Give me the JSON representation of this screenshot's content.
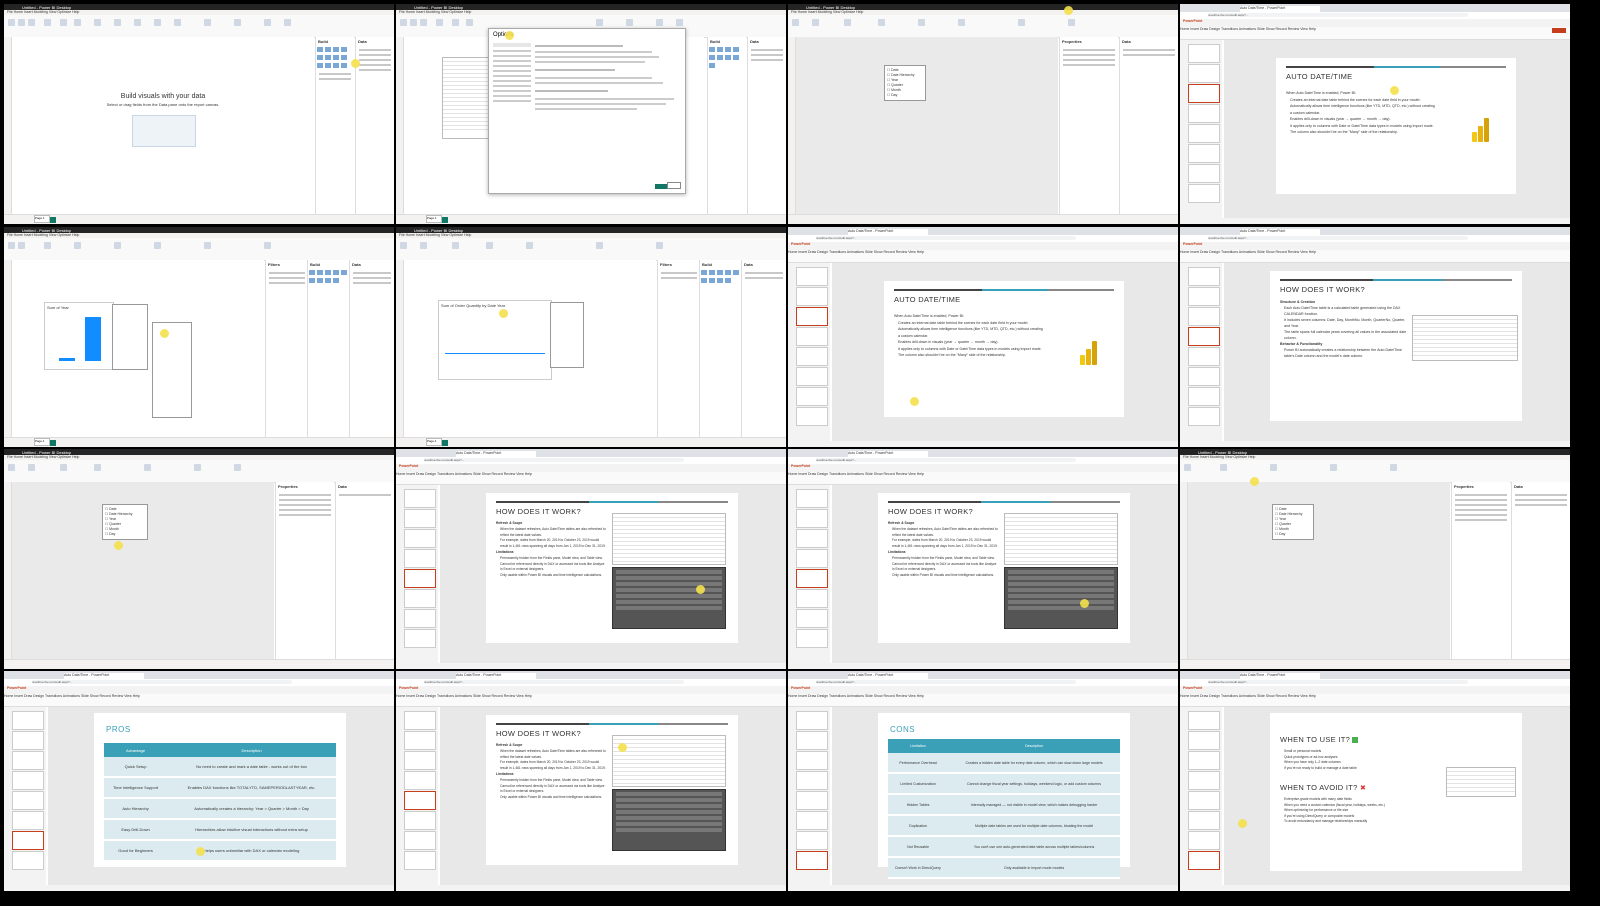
{
  "pbi": {
    "title": "Untitled - Power BI Desktop",
    "menu": "File Home Insert Modeling View Optimize Help",
    "build_title": "Build",
    "data_title": "Data",
    "filters_title": "Filters",
    "properties_title": "Properties",
    "page_tab": "Page 1",
    "empty_heading": "Build visuals with your data",
    "empty_sub": "Select or drag fields from the Data pane onto the report canvas.",
    "options_title": "Options",
    "chart1_title": "Sum of Year",
    "chart2_title": "Sum of Order Quantity by Date Year",
    "table_name": "Date",
    "date_fields": [
      "Date",
      "Date Hierarchy",
      "Year",
      "Quarter",
      "Month",
      "Day"
    ]
  },
  "browser": {
    "tab": "Auto Date/Time - PowerPoint",
    "url": "onedrive.live.com/edit.aspx?..."
  },
  "ppt": {
    "app": "PowerPoint",
    "ribbon": "Home Insert Draw Design Transitions Animations Slide Show Record Review View Help"
  },
  "slides": {
    "autodate": {
      "title": "AUTO DATE/TIME",
      "intro": "When Auto Date/Time is enabled, Power BI:",
      "bullets": [
        "Creates an internal date table behind the scenes for each date field in your model.",
        "Automatically allows time intelligence functions (like YTD, MTD, QTD, etc.) without creating a custom calendar.",
        "Enables drill-down in visuals (year → quarter → month → day).",
        "It applies only to columns with Date or Date/Time data types in models using Import mode. The column also shouldn't be on the \"Many\" side of the relationship."
      ]
    },
    "how1": {
      "title": "HOW DOES IT WORK?",
      "h1": "Structure & Creation",
      "b1": [
        "Each Auto Date/Time table is a calculated table generated using the DAX CALENDAR function.",
        "It includes seven columns: Date, Day, MonthNo, Month, QuarterNo, Quarter, and Year.",
        "The table spans full calendar years covering all values in the associated date column."
      ],
      "h2": "Behavior & Functionality",
      "b2": [
        "Power BI automatically creates a relationship between the Auto Date/Time table's Date column and the model's date column."
      ]
    },
    "how2": {
      "title": "HOW DOES IT WORK?",
      "h1": "Refresh & Scope",
      "b1": [
        "When the dataset refreshes, Auto Date/Time tables are also refreshed to reflect the latest date values.",
        "For example, dates from March 20, 2019 to October 23, 2019 would result in 1,461 rows spanning all days from Jan 1, 2019 to Dec 31, 2019."
      ],
      "h2": "Limitations",
      "b2": [
        "Permanently hidden from the Fields pane, Model view, and Table view.",
        "Cannot be referenced directly in DAX or accessed via tools like Analyze in Excel or external designers.",
        "Only usable within Power BI visuals and time intelligence calculations."
      ]
    },
    "pros": {
      "title": "PROS",
      "headers": [
        "Advantage",
        "Description"
      ],
      "rows": [
        [
          "Quick Setup",
          "No need to create and mark a date table - works out of the box"
        ],
        [
          "Time Intelligence Support",
          "Enables DAX functions like TOTALYTD, SAMEPERIODLASTYEAR, etc."
        ],
        [
          "Auto Hierarchy",
          "Automatically creates a hierarchy: Year > Quarter > Month > Day"
        ],
        [
          "Easy Drill-Down",
          "Hierarchies allow intuitive visual interactions without extra setup"
        ],
        [
          "Good for Beginners",
          "Helps users unfamiliar with DAX or calendar modeling"
        ]
      ]
    },
    "cons": {
      "title": "CONS",
      "headers": [
        "Limitation",
        "Description"
      ],
      "rows": [
        [
          "Performance Overhead",
          "Creates a hidden date table for every date column, which can slow down large models"
        ],
        [
          "Limited Customization",
          "Cannot change fiscal year settings, holidays, weekend logic, or add custom columns"
        ],
        [
          "Hidden Tables",
          "Internally managed — not visible in model view, which makes debugging harder"
        ],
        [
          "Duplication",
          "Multiple date tables are used for multiple date columns, bloating the model"
        ],
        [
          "Not Reusable",
          "You can't use one auto-generated date table across multiple tables/columns"
        ],
        [
          "Doesn't Work in DirectQuery",
          "Only available in Import mode models"
        ]
      ]
    },
    "when": {
      "title1": "WHEN TO USE IT?",
      "b1": [
        "Small or personal models",
        "Quick prototypes or ad-hoc analyses",
        "When you have only 1–2 date columns",
        "If you're not ready to build or manage a date table"
      ],
      "title2": "WHEN TO AVOID IT?",
      "b2": [
        "Enterprise-grade models with many date fields",
        "When you need a custom calendar (fiscal year, holidays, weeks, etc.)",
        "When optimizing for performance or file size",
        "If you're using DirectQuery or composite models",
        "To avoid redundancy and manage relationships manually"
      ]
    }
  }
}
